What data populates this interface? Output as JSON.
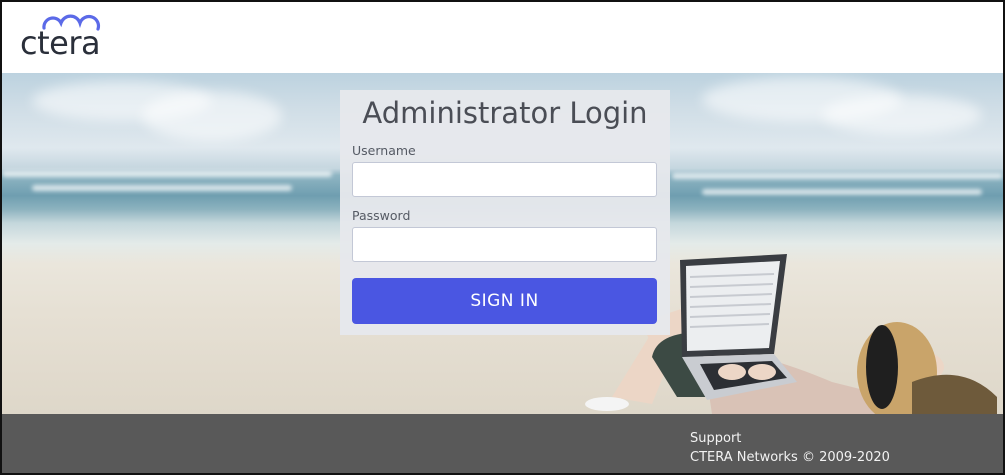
{
  "header": {
    "logo_text": "ctera"
  },
  "login": {
    "title": "Administrator Login",
    "username_label": "Username",
    "username_value": "",
    "password_label": "Password",
    "password_value": "",
    "signin_label": "SIGN IN"
  },
  "footer": {
    "support_label": "Support",
    "copyright": "CTERA Networks © 2009-2020"
  },
  "colors": {
    "accent": "#4a56e2",
    "logo": "#5b6ae8",
    "footer_bg": "#3c3c3c"
  }
}
